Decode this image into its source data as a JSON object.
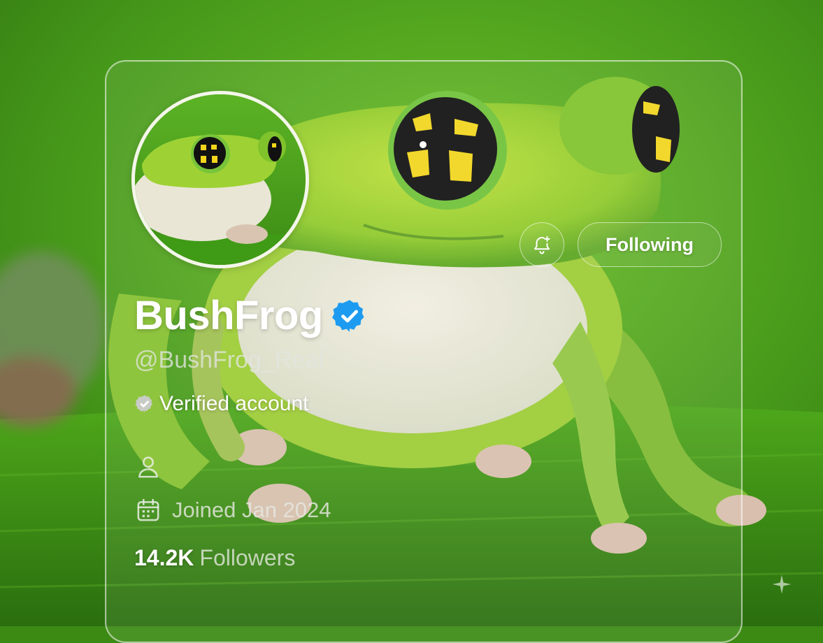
{
  "profile": {
    "display_name": "BushFrog",
    "handle": "@BushFrog_Real",
    "verified_text": "Verified account",
    "joined_text": "Joined Jan 2024",
    "followers_count": "14.2K",
    "followers_label": "Followers"
  },
  "actions": {
    "following_label": "Following"
  },
  "icons": {
    "notification": "bell-plus-icon",
    "verified_badge": "verified-badge-icon",
    "verified_small": "verified-small-icon",
    "person": "person-icon",
    "calendar": "calendar-icon",
    "sparkle": "sparkle-icon"
  },
  "colors": {
    "verified_blue": "#1d9bf0",
    "background_green": "#3c8a14"
  }
}
